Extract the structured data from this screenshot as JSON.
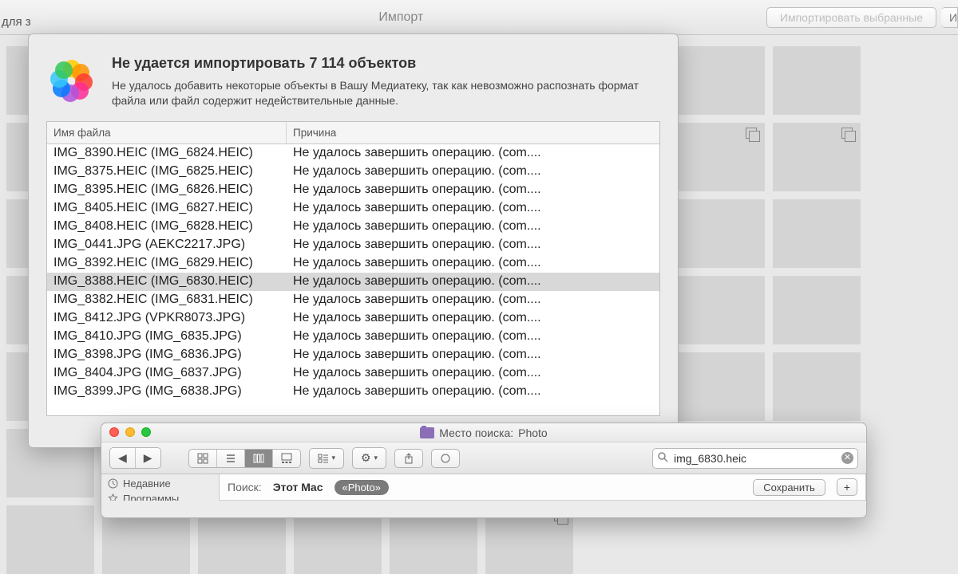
{
  "toolbar": {
    "title": "Импорт",
    "left_fragment": "для з",
    "import_selected": "Импортировать выбранные",
    "import_all": "И"
  },
  "dialog": {
    "title": "Не удается импортировать 7 114 объектов",
    "message": "Не удалось добавить некоторые объекты в Вашу Медиатеку, так как невозможно распознать формат файла или файл содержит недействительные данные.",
    "col_filename": "Имя файла",
    "col_reason": "Причина",
    "rows": [
      {
        "name": "IMG_8390.HEIC (IMG_6824.HEIC)",
        "reason": "Не удалось завершить операцию. (com....",
        "sel": false
      },
      {
        "name": "IMG_8375.HEIC (IMG_6825.HEIC)",
        "reason": "Не удалось завершить операцию. (com....",
        "sel": false
      },
      {
        "name": "IMG_8395.HEIC (IMG_6826.HEIC)",
        "reason": "Не удалось завершить операцию. (com....",
        "sel": false
      },
      {
        "name": "IMG_8405.HEIC (IMG_6827.HEIC)",
        "reason": "Не удалось завершить операцию. (com....",
        "sel": false
      },
      {
        "name": "IMG_8408.HEIC (IMG_6828.HEIC)",
        "reason": "Не удалось завершить операцию. (com....",
        "sel": false
      },
      {
        "name": "IMG_0441.JPG (AEKC2217.JPG)",
        "reason": "Не удалось завершить операцию. (com....",
        "sel": false
      },
      {
        "name": "IMG_8392.HEIC (IMG_6829.HEIC)",
        "reason": "Не удалось завершить операцию. (com....",
        "sel": false
      },
      {
        "name": "IMG_8388.HEIC (IMG_6830.HEIC)",
        "reason": "Не удалось завершить операцию. (com....",
        "sel": true
      },
      {
        "name": "IMG_8382.HEIC (IMG_6831.HEIC)",
        "reason": "Не удалось завершить операцию. (com....",
        "sel": false
      },
      {
        "name": "IMG_8412.JPG (VPKR8073.JPG)",
        "reason": "Не удалось завершить операцию. (com....",
        "sel": false
      },
      {
        "name": "IMG_8410.JPG (IMG_6835.JPG)",
        "reason": "Не удалось завершить операцию. (com....",
        "sel": false
      },
      {
        "name": "IMG_8398.JPG (IMG_6836.JPG)",
        "reason": "Не удалось завершить операцию. (com....",
        "sel": false
      },
      {
        "name": "IMG_8404.JPG (IMG_6837.JPG)",
        "reason": "Не удалось завершить операцию. (com....",
        "sel": false
      },
      {
        "name": "IMG_8399.JPG (IMG_6838.JPG)",
        "reason": "Не удалось завершить операцию. (com....",
        "sel": false
      }
    ]
  },
  "finder": {
    "title_prefix": "Место поиска:",
    "title_folder": "Photo",
    "search_value": "img_6830.heic",
    "sidebar": {
      "recent": "Недавние",
      "apps": "Программы"
    },
    "scope": {
      "label": "Поиск:",
      "this_mac": "Этот Mac",
      "folder_pill": "«Photo»",
      "save": "Сохранить",
      "plus": "+"
    }
  }
}
